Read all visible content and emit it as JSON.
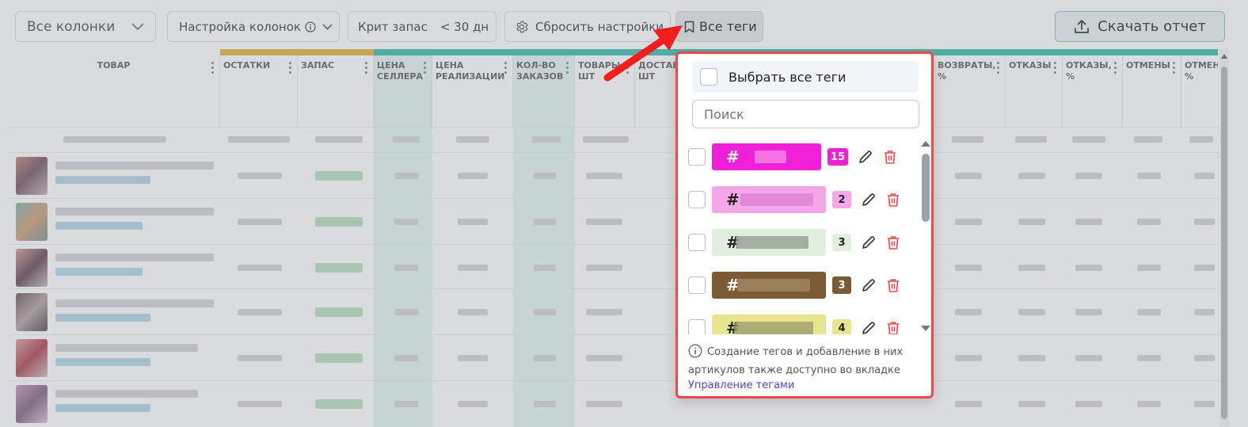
{
  "toolbar": {
    "all_columns": "Все колонки",
    "column_settings": "Настройка колонок",
    "crit_stock_label": "Крит запас",
    "crit_stock_value": "< 30 дн",
    "reset_label": "Сбросить настройки",
    "all_tags_label": "Все теги",
    "download_label": "Скачать отчет"
  },
  "table": {
    "columns": [
      {
        "label": "ТОВАР"
      },
      {
        "label": "ОСТАТКИ"
      },
      {
        "label": "ЗАПАС"
      },
      {
        "label": "ЦЕНА СЕЛЛЕРА"
      },
      {
        "label": "ЦЕНА РЕАЛИЗАЦИИ"
      },
      {
        "label": "КОЛ-ВО ЗАКАЗОВ"
      },
      {
        "label": "ТОВАРЫ ШТ"
      },
      {
        "label": "ДОСТАВ ШТ"
      },
      {
        "label": "ВОЗВРАТЫ, %"
      },
      {
        "label": "ОТКАЗЫ"
      },
      {
        "label": "ОТКАЗЫ, %"
      },
      {
        "label": "ОТМЕНЫ"
      },
      {
        "label": "ОТМЕНЫ %"
      }
    ]
  },
  "dropdown": {
    "select_all": "Выбрать все теги",
    "search_placeholder": "Поиск",
    "tags": [
      {
        "hash": "#",
        "count": "15",
        "bg": "#f21fd8",
        "text_color": "#ffffff",
        "count_bg": "#f21fd8",
        "count_color": "#ffffff"
      },
      {
        "hash": "#",
        "count": "2",
        "bg": "#f6a7ea",
        "text_color": "#222222",
        "count_bg": "#f6a7ea",
        "count_color": "#222222"
      },
      {
        "hash": "#",
        "count": "3",
        "bg": "#e1efdf",
        "text_color": "#222222",
        "count_bg": "#e1efdf",
        "count_color": "#222222"
      },
      {
        "hash": "#",
        "count": "3",
        "bg": "#7b5b34",
        "text_color": "#ffffff",
        "count_bg": "#7b5b34",
        "count_color": "#ffffff"
      },
      {
        "hash": "#",
        "count": "4",
        "bg": "#e6e690",
        "text_color": "#222222",
        "count_bg": "#e6e690",
        "count_color": "#222222"
      }
    ],
    "info_text": "Создание тегов и добавление в них артикулов также доступно во вкладке",
    "info_link": "Управление тегами"
  },
  "colors": {
    "accent_red": "#f0474c",
    "link": "#5b3ec8",
    "delete_icon": "#f0474c",
    "teal_strip": "#3fc1b0",
    "orange_strip": "#e6b54a"
  }
}
